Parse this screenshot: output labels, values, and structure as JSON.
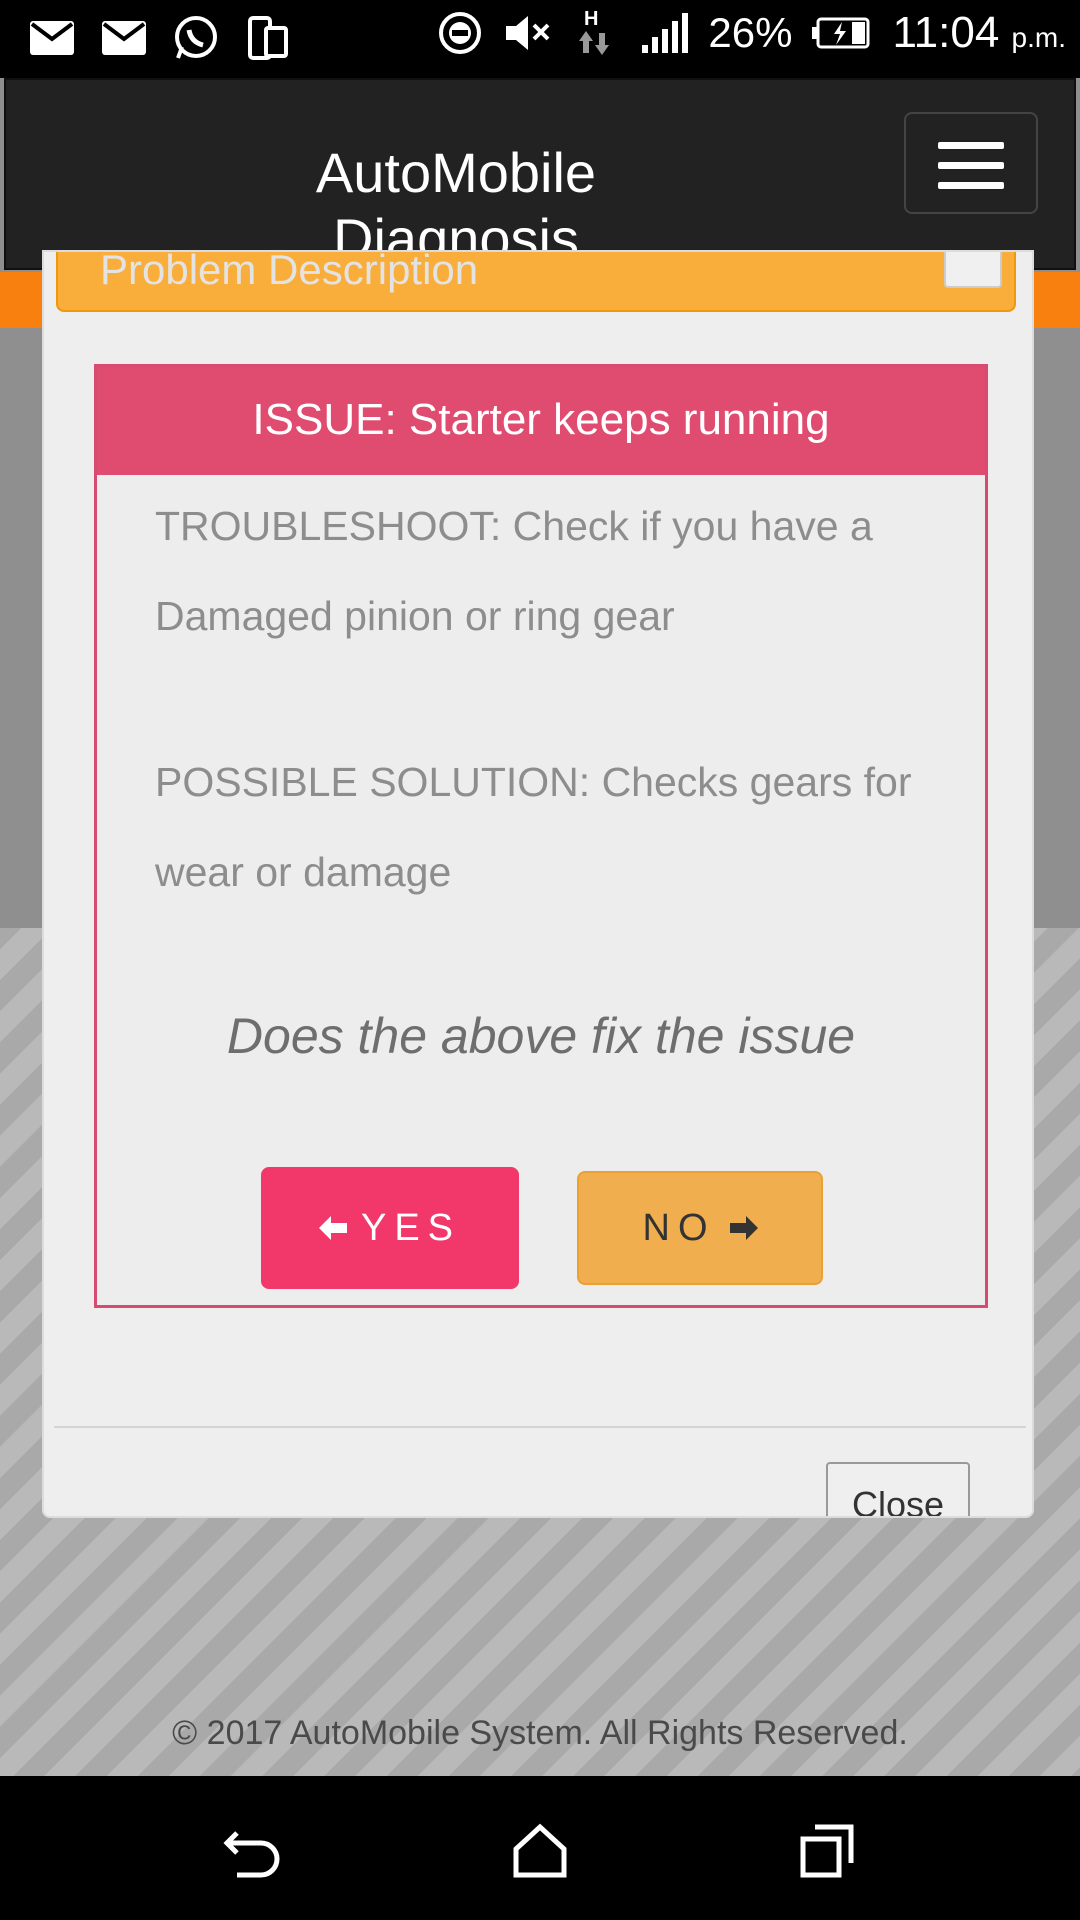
{
  "status_bar": {
    "battery": "26%",
    "time": "11:04",
    "ampm": "p.m.",
    "network": "H"
  },
  "navbar": {
    "brand_line1": "AutoMobile",
    "brand_line2": "Diagnosis"
  },
  "problem": {
    "label": "Problem Description"
  },
  "issue": {
    "heading": "ISSUE: Starter keeps running",
    "troubleshoot": "TROUBLESHOOT: Check if you have a Damaged pinion or ring gear",
    "solution": "POSSIBLE SOLUTION: Checks gears for wear or damage",
    "question": "Does the above fix the issue"
  },
  "buttons": {
    "yes": "YES",
    "no": "NO",
    "close": "Close"
  },
  "footer": {
    "copyright": "© 2017 AutoMobile System. All Rights Reserved."
  },
  "colors": {
    "orange": "#f8800f",
    "issue_head": "#e04b70",
    "yes": "#f2386a",
    "no": "#f0ae4f"
  }
}
